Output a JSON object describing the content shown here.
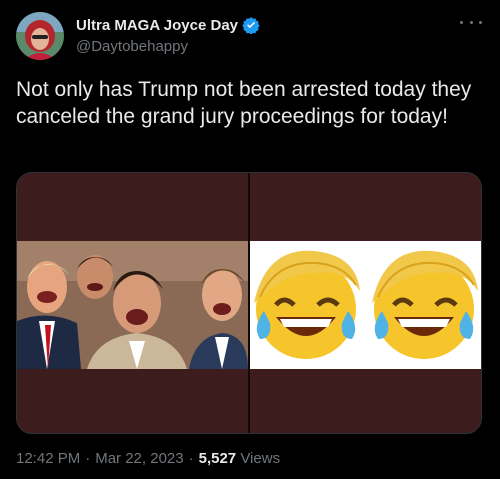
{
  "author": {
    "display_name": "Ultra MAGA Joyce Day",
    "handle": "@Daytobehappy",
    "verified": true,
    "badge_icon": "verified-badge-icon",
    "badge_color": "#1d9bf0"
  },
  "more_icon": "more-options-icon",
  "tweet": {
    "text": "Not only has Trump not been arrested today they canceled the grand jury proceedings for today!"
  },
  "media": {
    "left_panel": "photo of laughing men",
    "right_panel": "two laughing emoji with hair",
    "panel_color": "#3c1c1d"
  },
  "meta": {
    "time": "12:42 PM",
    "separator": "·",
    "date": "Mar 22, 2023",
    "views_count": "5,527",
    "views_label": "Views"
  },
  "colors": {
    "background": "#000000",
    "text": "#e7e9ea",
    "secondary": "#71767b"
  }
}
